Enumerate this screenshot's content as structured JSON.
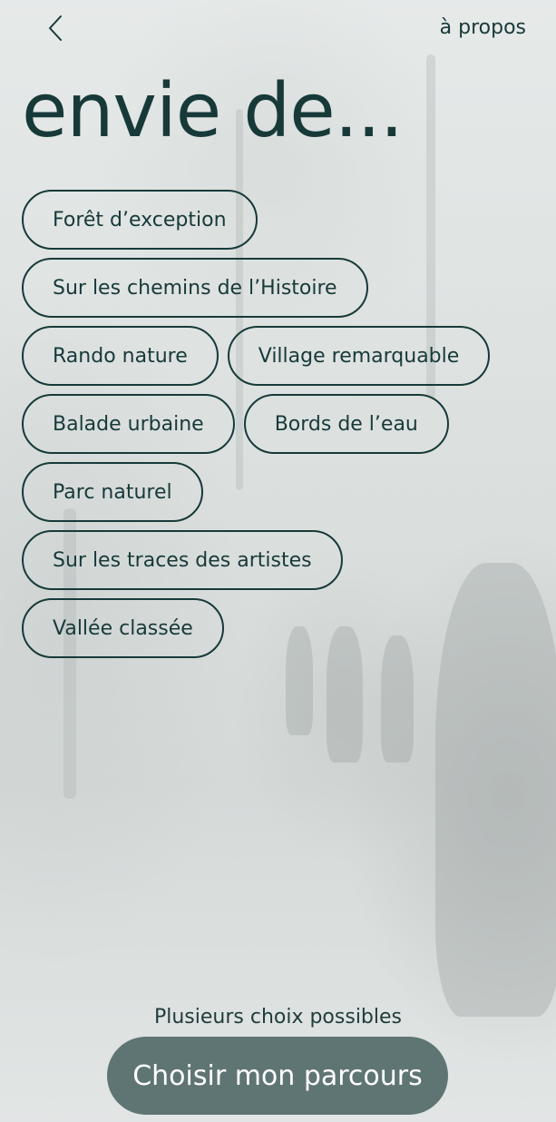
{
  "header": {
    "back_icon": "chevron-left-icon",
    "about_label": "à propos"
  },
  "title": "envie de...",
  "chips": [
    [
      "Forêt d’exception"
    ],
    [
      "Sur les chemins de l’Histoire"
    ],
    [
      "Rando nature",
      "Village remarquable"
    ],
    [
      "Balade urbaine",
      "Bords de l’eau"
    ],
    [
      "Parc naturel"
    ],
    [
      "Sur les traces des artistes"
    ],
    [
      "Vallée classée"
    ]
  ],
  "footer": {
    "hint": "Plusieurs choix possibles",
    "cta_label": "Choisir mon parcours"
  },
  "colors": {
    "text": "#173a39",
    "cta_background": "#5f7573",
    "cta_text": "#ffffff"
  }
}
